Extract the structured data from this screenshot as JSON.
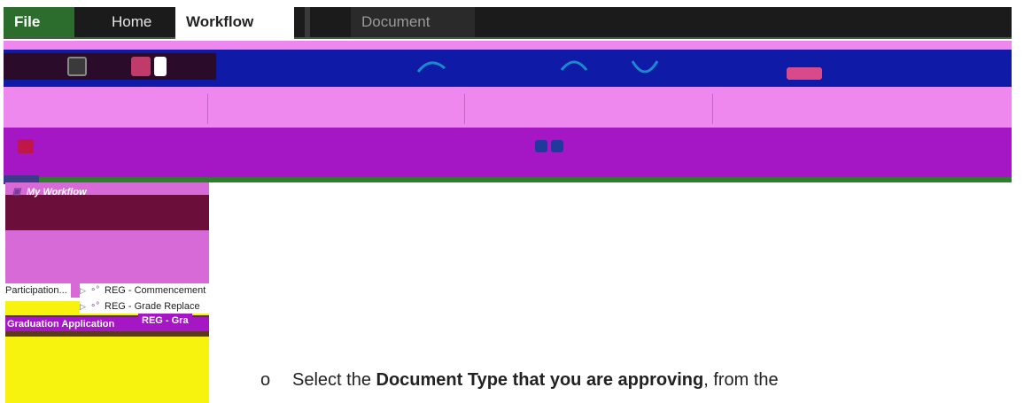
{
  "ribbon": {
    "tabs": [
      {
        "label": "File"
      },
      {
        "label": "Home"
      },
      {
        "label": "Workflow"
      },
      {
        "label": "Document"
      }
    ]
  },
  "tree": {
    "root": "My Workflow",
    "items": [
      {
        "label": "Participation..."
      },
      {
        "label": "REG - Commencement"
      },
      {
        "label": "REG - Grade Replace"
      },
      {
        "label": "REG - Gra"
      },
      {
        "label": "Graduation Application"
      }
    ]
  },
  "instruction": {
    "bullet": "o",
    "prefix": "Select the ",
    "bold": "Document Type that you are approving",
    "suffix": ", from the"
  },
  "colors": {
    "file_tab": "#2c6c2c",
    "ribbon_bg": "#ee88ee",
    "ribbon_blue": "#0f1aa6",
    "ribbon_purple": "#a516c4",
    "highlight_yellow": "#f7f20e"
  }
}
